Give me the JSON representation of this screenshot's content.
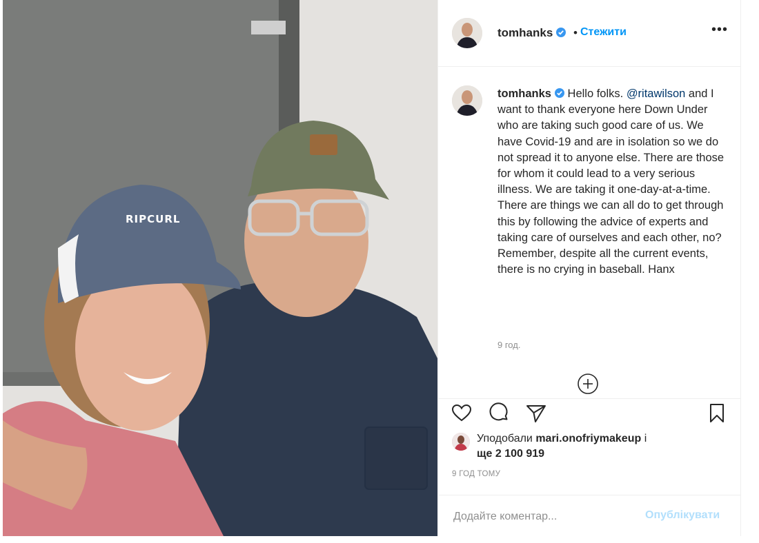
{
  "header": {
    "username": "tomhanks",
    "separator": "•",
    "follow_label": "Стежити",
    "more_label": "•••"
  },
  "post": {
    "caption_user": "tomhanks",
    "caption_pre": "Hello folks. ",
    "mention": "@ritawilson",
    "caption_post": " and I want to thank everyone here Down Under who are taking such good care of us. We have Covid-19 and are in isolation so we do not spread it to anyone else. There are those for whom it could lead to a very serious illness. We are taking it one-day-at-a-time. There are things we can all do to get through this by following the advice of experts and taking care of ourselves and each other, no? Remember, despite all the current events, there is no crying in baseball. Hanx",
    "caption_time": "9 год."
  },
  "likes": {
    "prefix": "Уподобали ",
    "user": "mari.onofriymakeup",
    "mid": " і",
    "more_prefix": "ще ",
    "count": "2 100 919"
  },
  "post_time": "9 ГОД ТОМУ",
  "comment": {
    "placeholder": "Додайте коментар...",
    "publish_label": "Опублікувати"
  },
  "icons": {
    "verified": "verified-badge-icon",
    "like": "heart-icon",
    "comment": "comment-bubble-icon",
    "share": "paper-plane-icon",
    "save": "bookmark-icon",
    "load_more": "plus-circle-icon"
  },
  "colors": {
    "accent": "#0095f6",
    "verified": "#3897f0",
    "publish_disabled": "#b2dffc",
    "mention": "#00376b"
  }
}
